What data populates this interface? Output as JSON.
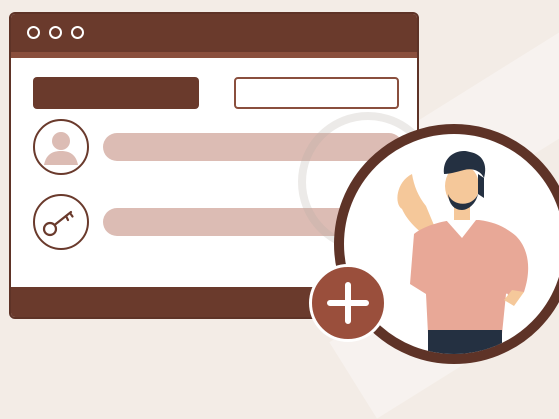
{
  "window": {
    "titlebar_controls": [
      "dot",
      "dot",
      "dot"
    ],
    "rows": [
      {
        "icon": "user-icon"
      },
      {
        "icon": "key-icon"
      }
    ]
  },
  "actions": {
    "add_icon": "plus-icon"
  },
  "illustration": {
    "subject": "person-illustration"
  },
  "colors": {
    "primary": "#6a3a2c",
    "accent": "#9a4f3c",
    "pill": "#dcbcb4",
    "background": "#f3ece6"
  }
}
